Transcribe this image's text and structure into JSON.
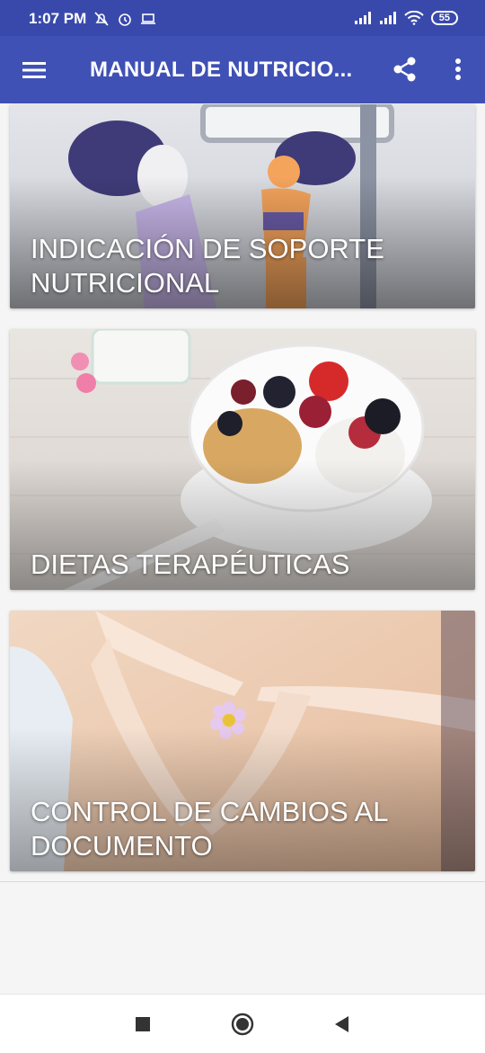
{
  "status_bar": {
    "time": "1:07 PM",
    "battery": "55",
    "left_icons": [
      "mute-alarm-icon",
      "alarm-icon",
      "laptop-icon"
    ],
    "right_icons": [
      "signal-icon",
      "signal-icon",
      "wifi-icon",
      "battery-icon"
    ]
  },
  "app_bar": {
    "title": "MANUAL DE NUTRICIO...",
    "menu_icon": "hamburger-menu-icon",
    "share_icon": "share-icon",
    "more_icon": "more-vertical-icon"
  },
  "cards": [
    {
      "label": "INDICACIÓN DE SOPORTE NUTRICIONAL"
    },
    {
      "label": "DIETAS TERAPÉUTICAS"
    },
    {
      "label": "CONTROL DE CAMBIOS AL DOCUMENTO"
    }
  ],
  "nav_bar": {
    "recent_icon": "square-recents-icon",
    "home_icon": "circle-home-icon",
    "back_icon": "triangle-back-icon"
  },
  "colors": {
    "status_bar": "#3949ab",
    "app_bar": "#3f51b5",
    "background": "#f5f5f5"
  }
}
